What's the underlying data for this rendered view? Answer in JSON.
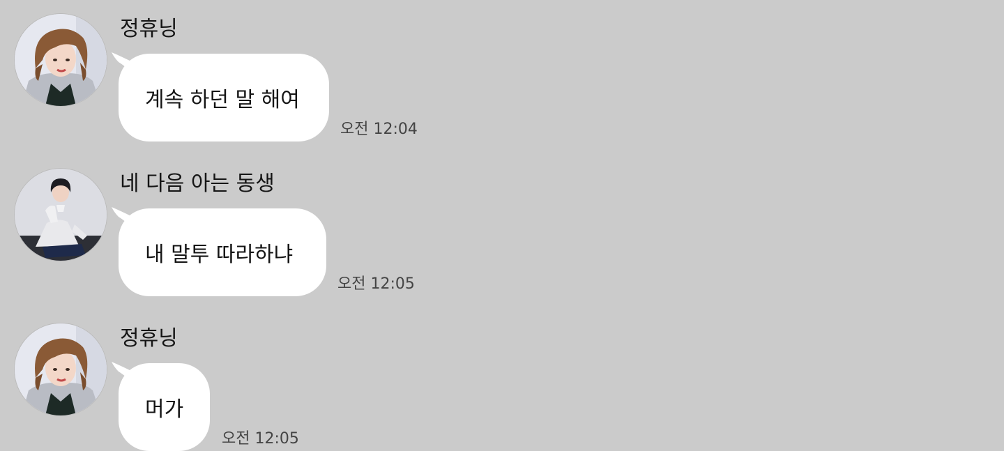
{
  "chat": {
    "background_color": "#cbcbcb",
    "bubble_color": "#ffffff",
    "messages": [
      {
        "sender": "정휴닝",
        "avatar_icon": "profile-photo-brown-hair",
        "text": "계속 하던 말 해여",
        "time": "오전 12:04"
      },
      {
        "sender": "네 다음 아는 동생",
        "avatar_icon": "profile-photo-dark-hair",
        "text": "내 말투 따라하냐",
        "time": "오전 12:05"
      },
      {
        "sender": "정휴닝",
        "avatar_icon": "profile-photo-brown-hair",
        "text": "머가",
        "time": "오전 12:05"
      }
    ]
  }
}
